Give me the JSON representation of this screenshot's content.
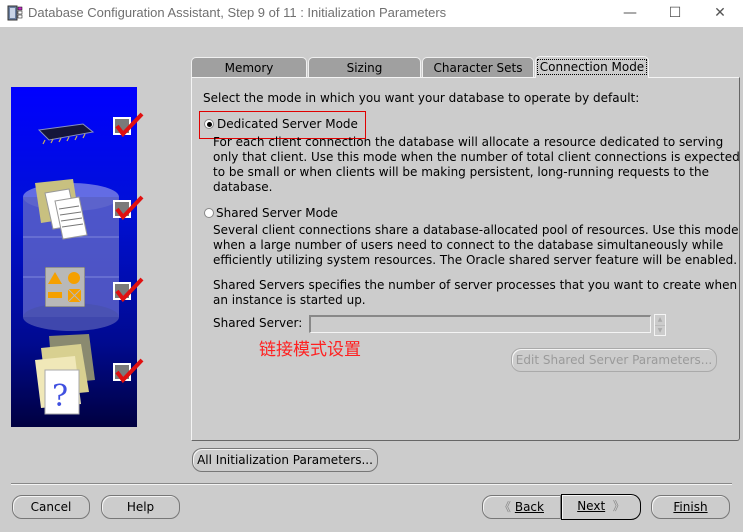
{
  "window": {
    "title": "Database Configuration Assistant, Step 9 of 11 : Initialization Parameters",
    "controls": {
      "minimize": "—",
      "maximize": "☐",
      "close": "✕"
    }
  },
  "left_panel": {
    "steps": [
      {
        "icon": "memory-chip-icon",
        "checked": true
      },
      {
        "icon": "document-folder-icon",
        "checked": true
      },
      {
        "icon": "shapes-icon",
        "checked": true
      },
      {
        "icon": "help-document-icon",
        "checked": true
      }
    ]
  },
  "tabs": [
    {
      "label": "Memory",
      "active": false
    },
    {
      "label": "Sizing",
      "active": false
    },
    {
      "label": "Character Sets",
      "active": false
    },
    {
      "label": "Connection Mode",
      "active": true
    }
  ],
  "connection_mode": {
    "intro": "Select the mode in which you want your database to operate by default:",
    "dedicated": {
      "label": "Dedicated Server Mode",
      "selected": true,
      "description": "For each client connection the database will allocate a resource dedicated to serving\nonly that client.  Use this mode when the number of total client connections is expected\nto be small or when clients will be making persistent, long-running requests to the\ndatabase."
    },
    "shared": {
      "label": "Shared Server Mode",
      "selected": false,
      "description": "Several client connections share a database-allocated pool of resources.  Use this mode\nwhen a large number of users need to connect to the database simultaneously while\nefficiently utilizing system resources.  The Oracle shared server feature will be enabled."
    },
    "shared_servers_note": "Shared Servers specifies the number of server processes that you want to create when\nan instance is started up.",
    "shared_server_label": "Shared Server:",
    "shared_server_value": "",
    "annotation": "链接模式设置",
    "edit_button": "Edit Shared Server Parameters..."
  },
  "all_params_button": "All Initialization Parameters...",
  "footer": {
    "cancel": "Cancel",
    "help": "Help",
    "back": "Back",
    "next": "Next",
    "finish": "Finish"
  }
}
